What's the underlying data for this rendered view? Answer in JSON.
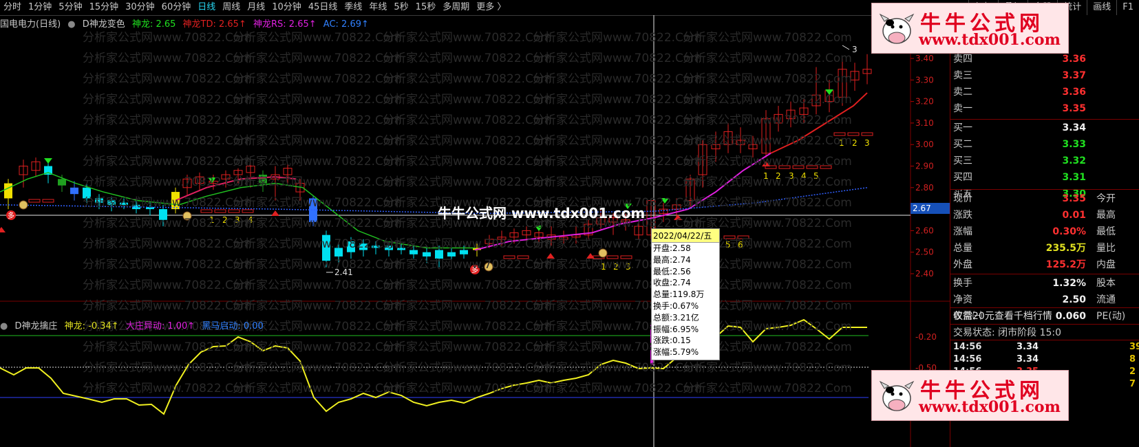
{
  "toolbar": {
    "items": [
      "分时",
      "1分钟",
      "5分钟",
      "15分钟",
      "30分钟",
      "60分钟",
      "日线",
      "周线",
      "月线",
      "10分钟",
      "45日线",
      "季线",
      "年线",
      "5秒",
      "15秒",
      "多周期",
      "更多 〉"
    ],
    "active": "日线",
    "right_items": [
      "复权",
      "叠加",
      "多股",
      "统计",
      "画线",
      "F1"
    ]
  },
  "main_indicator": {
    "stock_title": "国电电力(日线)",
    "formula_name": "D神龙变色",
    "values": [
      {
        "label": "神龙: 2.65",
        "color": "#20e020"
      },
      {
        "label": "神龙TD: 2.65↑",
        "color": "#e02020"
      },
      {
        "label": "神龙RS: 2.65↑",
        "color": "#e020e0"
      },
      {
        "label": "AC: 2.69↑",
        "color": "#3080ff"
      }
    ]
  },
  "sub_indicator": {
    "formula_name": "D神龙擒庄",
    "values": [
      {
        "label": "神龙: -0.34↑",
        "color": "#e0e020"
      },
      {
        "label": "大庄异动: 1.00↑",
        "color": "#e020e0"
      },
      {
        "label": "黑马启动: 0.00",
        "color": "#3080ff"
      }
    ]
  },
  "price_axis": [
    "3.40",
    "3.30",
    "3.20",
    "3.10",
    "3.00",
    "2.90",
    "2.80",
    "2.60",
    "2.50",
    "2.40"
  ],
  "sub_axis": [
    "-0.20",
    "-0.50"
  ],
  "current_price_marker": "2.67",
  "chart_annotations": {
    "low_label": "2.41",
    "high_label": "3",
    "counts_a": [
      "1",
      "2",
      "3",
      "4"
    ],
    "counts_b": [
      "1",
      "2",
      "3"
    ],
    "counts_c": [
      "1",
      "2",
      "3",
      "4",
      "5"
    ],
    "counts_d": [
      "1",
      "2",
      "3"
    ],
    "counts_e": [
      "5",
      "6"
    ],
    "duo": "多"
  },
  "tooltip": {
    "date": "2022/04/22/五",
    "lines": [
      "开盘:2.58",
      "最高:2.74",
      "最低:2.56",
      "收盘:2.74",
      "总量:119.8万",
      "换手:0.67%",
      "总额:3.21亿",
      "振幅:6.95%",
      "涨跌:0.15",
      "涨幅:5.79%"
    ]
  },
  "order_book": {
    "sells": [
      {
        "label": "卖四",
        "price": "3.36"
      },
      {
        "label": "卖三",
        "price": "3.37"
      },
      {
        "label": "卖二",
        "price": "3.36"
      },
      {
        "label": "卖一",
        "price": "3.35"
      }
    ],
    "buys": [
      {
        "label": "买一",
        "price": "3.34"
      },
      {
        "label": "买二",
        "price": "3.33"
      },
      {
        "label": "买三",
        "price": "3.32"
      },
      {
        "label": "买四",
        "price": "3.31"
      },
      {
        "label": "买五",
        "price": "3.30"
      }
    ]
  },
  "quote": [
    {
      "label": "现价",
      "value": "3.35",
      "label2": "今开",
      "color": "#ff3030"
    },
    {
      "label": "涨跌",
      "value": "0.01",
      "label2": "最高",
      "color": "#ff3030"
    },
    {
      "label": "涨幅",
      "value": "0.30%",
      "label2": "最低",
      "color": "#ff3030"
    },
    {
      "label": "总量",
      "value": "235.5万",
      "label2": "量比",
      "color": "#e0e020"
    },
    {
      "label": "外盘",
      "value": "125.2万",
      "label2": "内盘",
      "color": "#ff3030"
    }
  ],
  "stats": [
    {
      "label": "换手",
      "value": "1.32%",
      "label2": "股本"
    },
    {
      "label": "净资",
      "value": "2.50",
      "label2": "流通"
    },
    {
      "label": "收益㈠",
      "value": "0.060",
      "label2": "PE(动)"
    }
  ],
  "promo": "仅需20元查看千档行情",
  "trade_status": "交易状态: 闭市阶段 15:0",
  "ticks": [
    {
      "time": "14:56",
      "price": "3.34",
      "vol": "39",
      "color": "#f0f0f0"
    },
    {
      "time": "14:56",
      "price": "3.34",
      "vol": "8",
      "color": "#f0f0f0"
    },
    {
      "time": "14:56",
      "price": "3.35",
      "vol": "2",
      "color": "#ff3030"
    },
    {
      "time": "14:56",
      "price": "3.35",
      "vol": "7",
      "color": "#ff3030"
    }
  ],
  "ads": {
    "name": "牛牛公式网",
    "url": "www.tdx001.com"
  },
  "center_watermark": "牛牛公式网 www.tdx001.com",
  "bg_watermark": "分析家公式网www.70822.Com"
}
